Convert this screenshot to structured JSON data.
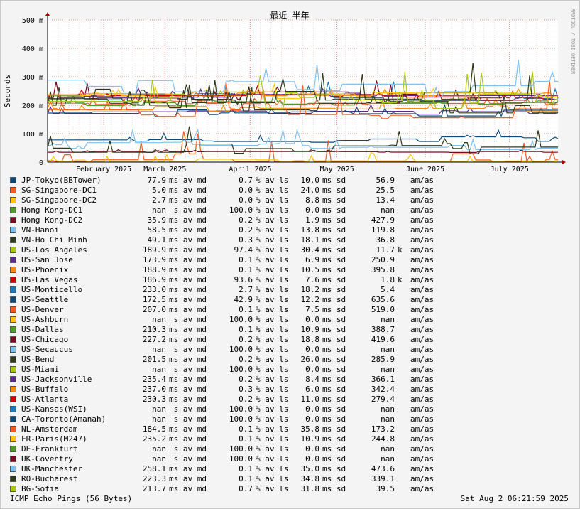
{
  "chart_data": {
    "type": "line",
    "title": "最近 半年",
    "ylabel": "Seconds",
    "side_label": "RRDTOOL / TOBI OETIKER",
    "ylim": [
      0,
      0.5
    ],
    "y_ticks": [
      {
        "v": 0,
        "label": "0"
      },
      {
        "v": 0.1,
        "label": "100 m"
      },
      {
        "v": 0.2,
        "label": "200 m"
      },
      {
        "v": 0.3,
        "label": "300 m"
      },
      {
        "v": 0.4,
        "label": "400 m"
      },
      {
        "v": 0.5,
        "label": "500 m"
      }
    ],
    "x_ticks": [
      "February 2025",
      "March 2025",
      "April 2025",
      "May 2025",
      "June 2025",
      "July 2025"
    ],
    "series": [
      {
        "name": "JP-Tokyo(BBTower)",
        "color": "#0b4a7a",
        "avg": "77.9",
        "avg_u": "ms",
        "loss": "0.7",
        "sd": "10.0",
        "ratio": "56.9",
        "ratio_u": ""
      },
      {
        "name": "SG-Singapore-DC1",
        "color": "#ff5a1e",
        "avg": "5.0",
        "avg_u": "ms",
        "loss": "0.0",
        "sd": "24.0",
        "ratio": "25.5",
        "ratio_u": ""
      },
      {
        "name": "SG-Singapore-DC2",
        "color": "#ffc800",
        "avg": "2.7",
        "avg_u": "ms",
        "loss": "0.0",
        "sd": "8.8",
        "ratio": "13.4",
        "ratio_u": ""
      },
      {
        "name": "Hong Kong-DC1",
        "color": "#4c9a2a",
        "avg": "nan",
        "avg_u": " s",
        "loss": "100.0",
        "sd": "0.0",
        "ratio": "nan",
        "ratio_u": ""
      },
      {
        "name": "Hong Kong-DC2",
        "color": "#7a0a20",
        "avg": "35.9",
        "avg_u": "ms",
        "loss": "0.2",
        "sd": "1.9",
        "ratio": "427.9",
        "ratio_u": ""
      },
      {
        "name": "VN-Hanoi",
        "color": "#7ec0ee",
        "avg": "58.5",
        "avg_u": "ms",
        "loss": "0.2",
        "sd": "13.8",
        "ratio": "119.8",
        "ratio_u": ""
      },
      {
        "name": "VN-Ho Chi Minh",
        "color": "#2f3a1a",
        "avg": "49.1",
        "avg_u": "ms",
        "loss": "0.3",
        "sd": "18.1",
        "ratio": "36.8",
        "ratio_u": ""
      },
      {
        "name": "US-Los Angeles",
        "color": "#a8c814",
        "avg": "189.9",
        "avg_u": "ms",
        "loss": "97.4",
        "sd": "30.4",
        "ratio": "11.7",
        "ratio_u": "k"
      },
      {
        "name": "US-San Jose",
        "color": "#5a2a8a",
        "avg": "173.9",
        "avg_u": "ms",
        "loss": "0.1",
        "sd": "6.9",
        "ratio": "250.9",
        "ratio_u": ""
      },
      {
        "name": "US-Phoenix",
        "color": "#ff8c00",
        "avg": "188.9",
        "avg_u": "ms",
        "loss": "0.1",
        "sd": "10.5",
        "ratio": "395.8",
        "ratio_u": ""
      },
      {
        "name": "US-Las Vegas",
        "color": "#cc0000",
        "avg": "186.9",
        "avg_u": "ms",
        "loss": "93.6",
        "sd": "7.6",
        "ratio": "1.8",
        "ratio_u": "k"
      },
      {
        "name": "US-Monticello",
        "color": "#1e7ab8",
        "avg": "233.0",
        "avg_u": "ms",
        "loss": "2.7",
        "sd": "18.2",
        "ratio": "5.4",
        "ratio_u": ""
      },
      {
        "name": "US-Seattle",
        "color": "#0b4a7a",
        "avg": "172.5",
        "avg_u": "ms",
        "loss": "42.9",
        "sd": "12.2",
        "ratio": "635.6",
        "ratio_u": ""
      },
      {
        "name": "US-Denver",
        "color": "#ff5a1e",
        "avg": "207.0",
        "avg_u": "ms",
        "loss": "0.1",
        "sd": "7.5",
        "ratio": "519.0",
        "ratio_u": ""
      },
      {
        "name": "US-Ashburn",
        "color": "#ffc800",
        "avg": "nan",
        "avg_u": " s",
        "loss": "100.0",
        "sd": "0.0",
        "ratio": "nan",
        "ratio_u": ""
      },
      {
        "name": "US-Dallas",
        "color": "#4c9a2a",
        "avg": "210.3",
        "avg_u": "ms",
        "loss": "0.1",
        "sd": "10.9",
        "ratio": "388.7",
        "ratio_u": ""
      },
      {
        "name": "US-Chicago",
        "color": "#7a0a20",
        "avg": "227.2",
        "avg_u": "ms",
        "loss": "0.2",
        "sd": "18.8",
        "ratio": "419.6",
        "ratio_u": ""
      },
      {
        "name": "US-Secaucus",
        "color": "#7ec0ee",
        "avg": "nan",
        "avg_u": " s",
        "loss": "100.0",
        "sd": "0.0",
        "ratio": "nan",
        "ratio_u": ""
      },
      {
        "name": "US-Bend",
        "color": "#2f3a1a",
        "avg": "201.5",
        "avg_u": "ms",
        "loss": "0.2",
        "sd": "26.0",
        "ratio": "285.9",
        "ratio_u": ""
      },
      {
        "name": "US-Miami",
        "color": "#a8c814",
        "avg": "nan",
        "avg_u": " s",
        "loss": "100.0",
        "sd": "0.0",
        "ratio": "nan",
        "ratio_u": ""
      },
      {
        "name": "US-Jacksonville",
        "color": "#5a2a8a",
        "avg": "235.4",
        "avg_u": "ms",
        "loss": "0.2",
        "sd": "8.4",
        "ratio": "366.1",
        "ratio_u": ""
      },
      {
        "name": "US-Buffalo",
        "color": "#ff8c00",
        "avg": "237.0",
        "avg_u": "ms",
        "loss": "0.3",
        "sd": "6.0",
        "ratio": "342.4",
        "ratio_u": ""
      },
      {
        "name": "US-Atlanta",
        "color": "#cc0000",
        "avg": "230.3",
        "avg_u": "ms",
        "loss": "0.2",
        "sd": "11.0",
        "ratio": "279.4",
        "ratio_u": ""
      },
      {
        "name": "US-Kansas(WSI)",
        "color": "#1e7ab8",
        "avg": "nan",
        "avg_u": " s",
        "loss": "100.0",
        "sd": "0.0",
        "ratio": "nan",
        "ratio_u": ""
      },
      {
        "name": "CA-Toronto(Amanah)",
        "color": "#0b4a7a",
        "avg": "nan",
        "avg_u": " s",
        "loss": "100.0",
        "sd": "0.0",
        "ratio": "nan",
        "ratio_u": ""
      },
      {
        "name": "NL-Amsterdam",
        "color": "#ff5a1e",
        "avg": "184.5",
        "avg_u": "ms",
        "loss": "0.1",
        "sd": "35.8",
        "ratio": "173.2",
        "ratio_u": ""
      },
      {
        "name": "FR-Paris(M247)",
        "color": "#ffc800",
        "avg": "235.2",
        "avg_u": "ms",
        "loss": "0.1",
        "sd": "10.9",
        "ratio": "244.8",
        "ratio_u": ""
      },
      {
        "name": "DE-Frankfurt",
        "color": "#4c9a2a",
        "avg": "nan",
        "avg_u": " s",
        "loss": "100.0",
        "sd": "0.0",
        "ratio": "nan",
        "ratio_u": ""
      },
      {
        "name": "UK-Coventry",
        "color": "#7a0a20",
        "avg": "nan",
        "avg_u": " s",
        "loss": "100.0",
        "sd": "0.0",
        "ratio": "nan",
        "ratio_u": ""
      },
      {
        "name": "UK-Manchester",
        "color": "#7ec0ee",
        "avg": "258.1",
        "avg_u": "ms",
        "loss": "0.1",
        "sd": "35.0",
        "ratio": "473.6",
        "ratio_u": ""
      },
      {
        "name": "RO-Bucharest",
        "color": "#2f3a1a",
        "avg": "223.3",
        "avg_u": "ms",
        "loss": "0.1",
        "sd": "34.8",
        "ratio": "339.1",
        "ratio_u": ""
      },
      {
        "name": "BG-Sofia",
        "color": "#a8c814",
        "avg": "213.7",
        "avg_u": "ms",
        "loss": "0.7",
        "sd": "31.8",
        "ratio": "39.5",
        "ratio_u": ""
      }
    ],
    "units": {
      "avg": "av md",
      "loss": "% av ls",
      "sd": "ms sd",
      "ratio": "am/as"
    }
  },
  "footer": {
    "left": "ICMP Echo Pings (56 Bytes)",
    "right": "Sat Aug  2 06:21:59 2025"
  }
}
